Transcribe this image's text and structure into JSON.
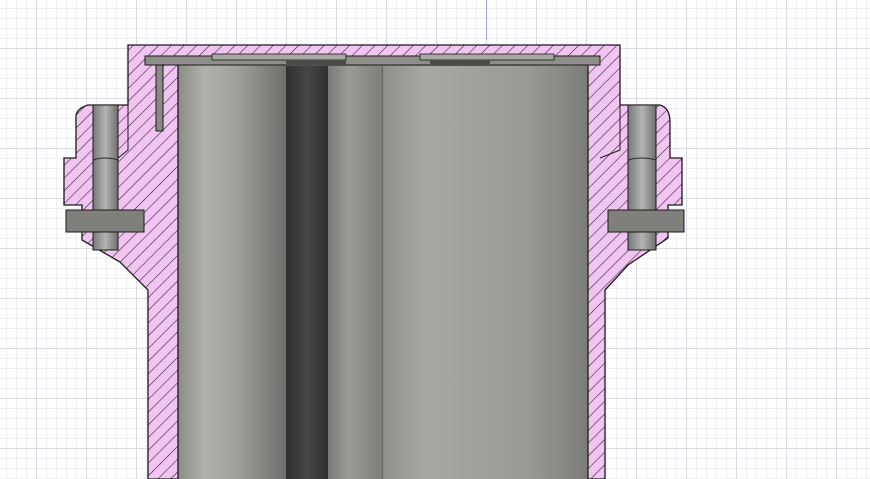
{
  "colors": {
    "section_fill": "#f1c4f1",
    "hatch": "#2a1a2a",
    "outline": "#1a1a1a",
    "bore_light": "#9c9d98",
    "bore_mid": "#83847f",
    "bore_dark": "#3a3b3a",
    "metal": "#7f807c",
    "grid_major": "#d9dde3",
    "grid_minor": "#eef0f3",
    "axis": "#9aa6e8"
  },
  "scene": {
    "view": "section-analysis",
    "icons": [
      "section-plane",
      "bore",
      "bolt-insert"
    ]
  }
}
